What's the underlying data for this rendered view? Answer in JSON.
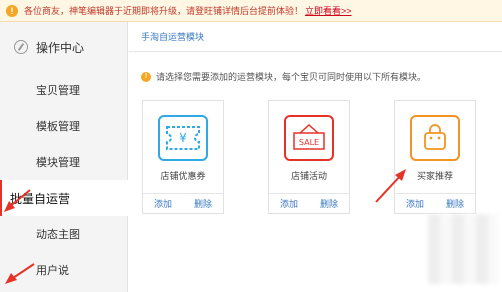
{
  "notice": {
    "text": "各位商友，神笔编辑器于近期即将升级，请登旺铺详情后台提前体验！",
    "link": "立即看看>>"
  },
  "sidebar": {
    "header": "操作中心",
    "items": [
      {
        "label": "宝贝管理"
      },
      {
        "label": "模板管理"
      },
      {
        "label": "模块管理"
      },
      {
        "label": "批量自运营"
      },
      {
        "label": "动态主图"
      },
      {
        "label": "用户说"
      }
    ]
  },
  "main": {
    "breadcrumb": "手淘自运营模块",
    "hint": "请选择您需要添加的运营模块，每个宝贝可同时使用以下所有模块。",
    "cards": [
      {
        "title": "店铺优惠券",
        "icon": "coupon-icon",
        "add": "添加",
        "delete": "删除",
        "color": "#2fa8e3"
      },
      {
        "title": "店铺活动",
        "icon": "sale-icon",
        "add": "添加",
        "delete": "删除",
        "color": "#e5332a",
        "icon_text": "SALE"
      },
      {
        "title": "买家推荐",
        "icon": "bag-icon",
        "add": "添加",
        "delete": "删除",
        "color": "#f29423"
      }
    ]
  },
  "colors": {
    "accent": "#e5332a",
    "link": "#3a78c3",
    "warning": "#f5a623"
  }
}
